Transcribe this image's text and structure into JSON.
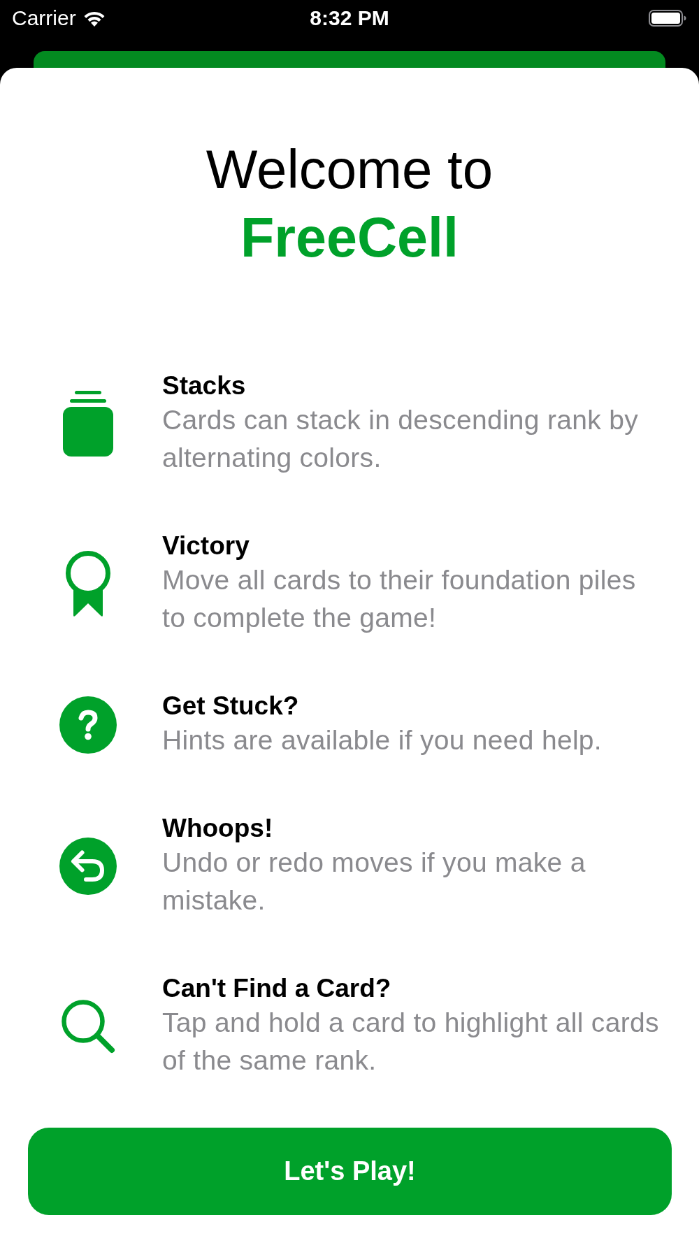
{
  "status_bar": {
    "carrier": "Carrier",
    "time": "8:32 PM"
  },
  "header": {
    "line_1": "Welcome to",
    "app_name": "FreeCell"
  },
  "features": [
    {
      "kind": "stack",
      "title": "Stacks",
      "description": "Cards can stack in descending rank by alternating colors."
    },
    {
      "kind": "ribbon",
      "title": "Victory",
      "description": "Move all cards to their foundation piles to complete the game!"
    },
    {
      "kind": "question",
      "title": "Get Stuck?",
      "description": "Hints are available if you need help."
    },
    {
      "kind": "undo",
      "title": "Whoops!",
      "description": "Undo or redo moves if you make a mistake."
    },
    {
      "kind": "search",
      "title": "Can't Find a Card?",
      "description": "Tap and hold a card to highlight all cards of the same rank."
    }
  ],
  "primary_button": {
    "label": "Let's Play!"
  }
}
